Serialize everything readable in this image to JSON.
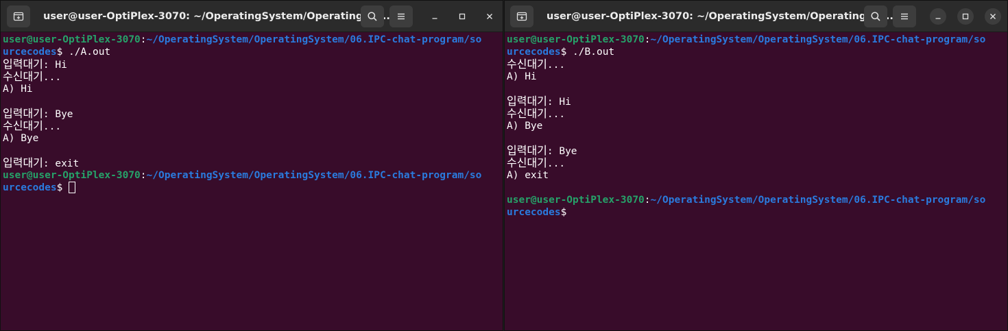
{
  "window_a": {
    "title": "user@user-OptiPlex-3070: ~/OperatingSystem/OperatingSys...",
    "prompt": {
      "user": "user@user-OptiPlex-3070",
      "colon": ":",
      "path_line1": "~/OperatingSystem/OperatingSystem/06.IPC-chat-program/so",
      "path_line2": "urcecodes",
      "dollar": "$"
    },
    "command": " ./A.out",
    "lines": {
      "l1_label": "입력대기",
      "l1_value": ": Hi",
      "l2_label": "수신대기",
      "l2_value": "...",
      "l3": "A) Hi",
      "l5_label": "입력대기",
      "l5_value": ": Bye",
      "l6_label": "수신대기",
      "l6_value": "...",
      "l7": "A) Bye",
      "l9_label": "입력대기",
      "l9_value": ": exit"
    }
  },
  "window_b": {
    "title": "user@user-OptiPlex-3070: ~/OperatingSystem/OperatingSys...",
    "prompt": {
      "user": "user@user-OptiPlex-3070",
      "colon": ":",
      "path_line1": "~/OperatingSystem/OperatingSystem/06.IPC-chat-program/so",
      "path_line2": "urcecodes",
      "dollar": "$"
    },
    "command": " ./B.out",
    "lines": {
      "l1_label": "수신대기",
      "l1_value": "...",
      "l2": "A) Hi",
      "l4_label": "입력대기",
      "l4_value": ": Hi",
      "l5_label": "수신대기",
      "l5_value": "...",
      "l6": "A) Bye",
      "l8_label": "입력대기",
      "l8_value": ": Bye",
      "l9_label": "수신대기",
      "l9_value": "...",
      "l10": "A) exit"
    }
  },
  "icons": {
    "new_tab": "new-tab-icon",
    "search": "search-icon",
    "menu": "hamburger-menu-icon",
    "minimize": "minimize-icon",
    "maximize": "maximize-icon",
    "close": "close-icon"
  },
  "colors": {
    "terminal_bg": "#380c2a",
    "titlebar_bg": "#2b2b2b",
    "prompt_user": "#26a269",
    "prompt_path": "#2a7bde",
    "text": "#ffffff"
  }
}
